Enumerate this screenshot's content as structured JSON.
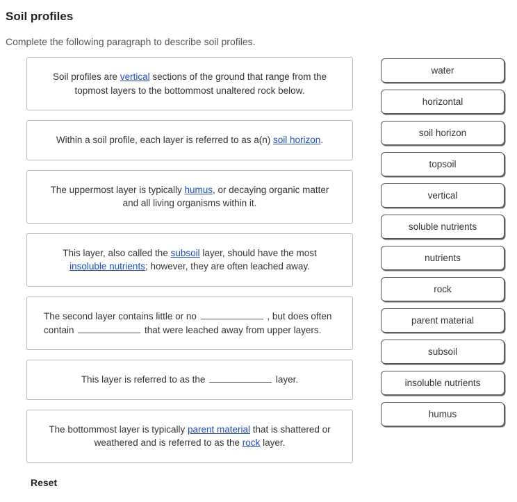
{
  "title": "Soil profiles",
  "instructions": "Complete the following paragraph to describe soil profiles.",
  "sentences": {
    "s1": {
      "pre": "Soil profiles are ",
      "fill": "vertical",
      "post": " sections of the ground that range from the topmost layers to the bottommost unaltered rock below."
    },
    "s2": {
      "pre": "Within a soil profile, each layer is referred to as a(n) ",
      "fill": "soil horizon",
      "post": "."
    },
    "s3": {
      "pre": "The uppermost layer is typically ",
      "fill": "humus",
      "post": ", or decaying organic matter and all living organisms within it."
    },
    "s4": {
      "pre": "This layer, also called the ",
      "fill1": "subsoil",
      "mid": " layer, should have the most ",
      "fill2": "insoluble nutrients",
      "post": "; however, they are often leached away."
    },
    "s5": {
      "pre": "The second layer contains little or no ",
      "mid": " , but does often contain ",
      "post": " that were leached away from upper layers."
    },
    "s6": {
      "pre": "This layer is referred to as the ",
      "post": " layer."
    },
    "s7": {
      "pre": "The bottommost layer is typically ",
      "fill1": "parent material",
      "mid": " that is shattered or weathered and is referred to as the ",
      "fill2": "rock",
      "post": " layer."
    }
  },
  "options": [
    "water",
    "horizontal",
    "soil horizon",
    "topsoil",
    "vertical",
    "soluble nutrients",
    "nutrients",
    "rock",
    "parent material",
    "subsoil",
    "insoluble nutrients",
    "humus"
  ],
  "reset_label": "Reset"
}
